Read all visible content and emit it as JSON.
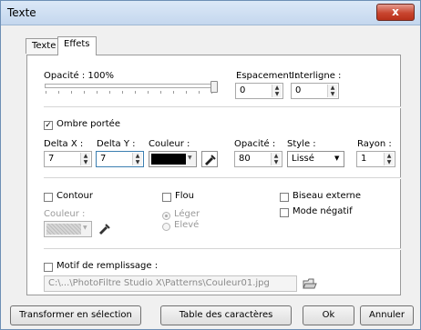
{
  "window": {
    "title": "Texte",
    "close_label": "x"
  },
  "tabs": [
    {
      "label": "Texte"
    },
    {
      "label": "Effets"
    }
  ],
  "effects": {
    "opacity_label": "Opacité : 100%",
    "opacity_value": 100,
    "espacement_label": "Espacement :",
    "espacement_value": "0",
    "interligne_label": "Interligne :",
    "interligne_value": "0",
    "ombre": {
      "label": "Ombre portée",
      "checked": true,
      "delta_x_label": "Delta X :",
      "delta_x_value": "7",
      "delta_y_label": "Delta Y :",
      "delta_y_value": "7",
      "couleur_label": "Couleur :",
      "color": "#000000",
      "opacite_label": "Opacité :",
      "opacite_value": "80",
      "style_label": "Style :",
      "style_value": "Lissé",
      "rayon_label": "Rayon :",
      "rayon_value": "1"
    },
    "contour": {
      "label": "Contour",
      "couleur_label": "Couleur :",
      "color": "#c8c8c8"
    },
    "flou": {
      "label": "Flou",
      "options": [
        "Léger",
        "Elevé"
      ]
    },
    "biseau_label": "Biseau externe",
    "mode_negatif_label": "Mode négatif",
    "motif": {
      "label": "Motif de remplissage :",
      "path": "C:\\...\\PhotoFiltre Studio X\\Patterns\\Couleur01.jpg"
    }
  },
  "buttons": {
    "transformer": "Transformer en sélection",
    "table": "Table des caractères",
    "ok": "Ok",
    "annuler": "Annuler"
  }
}
